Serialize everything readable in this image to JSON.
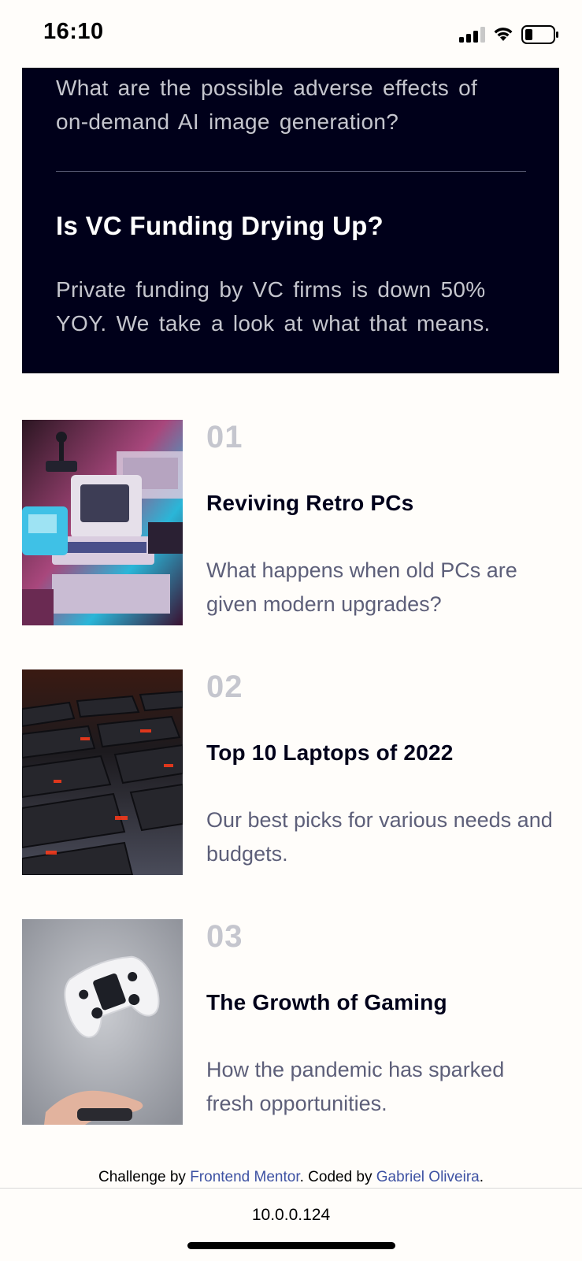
{
  "status_bar": {
    "time": "16:10",
    "icons": [
      "signal-icon",
      "wifi-icon",
      "battery-icon"
    ]
  },
  "new_panel": {
    "items": [
      {
        "title": "",
        "description": "What are the possible adverse effects of on-demand AI image generation?"
      },
      {
        "title": "Is VC Funding Drying Up?",
        "description": "Private funding by VC firms is down 50% YOY. We take a look at what that means."
      }
    ]
  },
  "articles": [
    {
      "number": "01",
      "title": "Reviving Retro PCs",
      "description": "What happens when old PCs are given modern upgrades?",
      "image": "retro-pc-image"
    },
    {
      "number": "02",
      "title": "Top 10 Laptops of 2022",
      "description": "Our best picks for various needs and budgets.",
      "image": "laptop-keyboard-image"
    },
    {
      "number": "03",
      "title": "The Growth of Gaming",
      "description": "How the pandemic has sparked fresh opportunities.",
      "image": "game-controller-image"
    }
  ],
  "footer": {
    "prefix": "Challenge by ",
    "link1": "Frontend Mentor",
    "middle": ". Coded by ",
    "link2": "Gabriel Oliveira",
    "suffix": "."
  },
  "browser": {
    "url": "10.0.0.124"
  },
  "colors": {
    "dark_panel": "#00001a",
    "muted": "#c5c6ce",
    "body_text": "#5d5f79",
    "link": "#3e52a3"
  }
}
